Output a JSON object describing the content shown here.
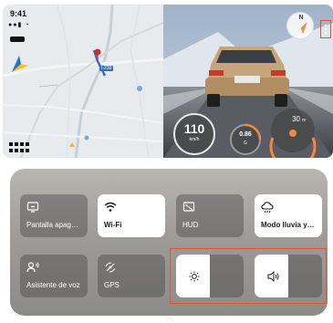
{
  "status": {
    "time": "9:41",
    "signal": "●●▮ ◔"
  },
  "map": {
    "badge": "I-230"
  },
  "camera": {
    "compass_letter": "N",
    "speed_value": "110",
    "speed_unit": "km/h",
    "gforce_value": "0.86",
    "gforce_unit": "G",
    "distance_value": "30",
    "distance_unit": "m"
  },
  "control_center": {
    "tiles": [
      {
        "id": "screen-off",
        "label": "Pantalla apagada",
        "active": false
      },
      {
        "id": "wifi",
        "label": "Wi-Fi",
        "active": true
      },
      {
        "id": "hud",
        "label": "HUD",
        "active": false
      },
      {
        "id": "rain-mode",
        "label": "Modo lluvia y n...",
        "active": true
      },
      {
        "id": "voice-assistant",
        "label": "Asistente de voz",
        "active": false
      },
      {
        "id": "gps",
        "label": "GPS",
        "active": false
      }
    ],
    "sliders": [
      {
        "id": "brightness",
        "icon": "sun-icon",
        "level": 0.5
      },
      {
        "id": "volume",
        "icon": "speaker-icon",
        "level": 0.5
      }
    ]
  },
  "colors": {
    "accent_highlight": "#e0562b",
    "gauge_orange": "#f28a3b"
  }
}
